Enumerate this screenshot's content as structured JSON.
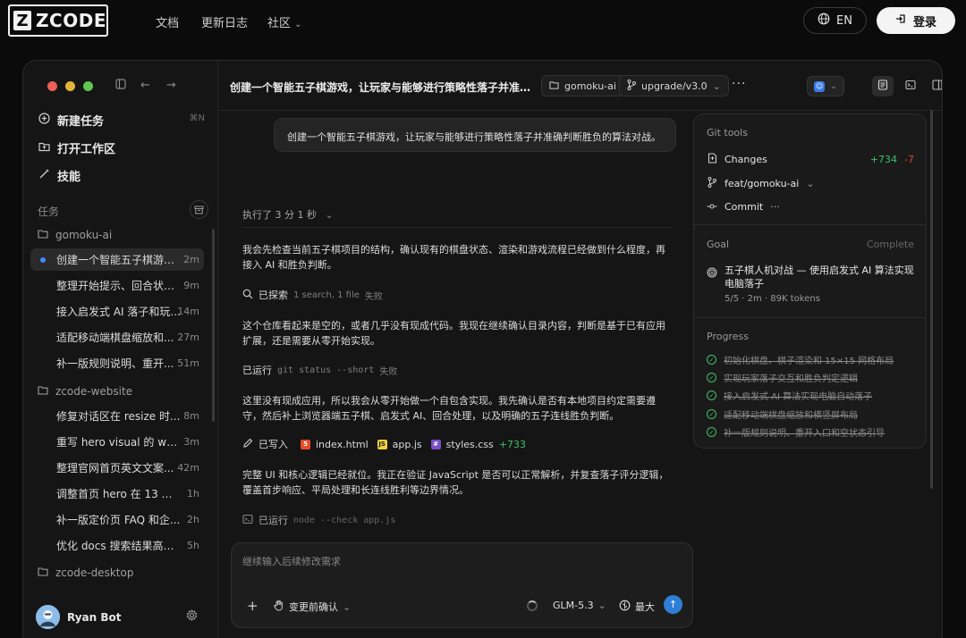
{
  "site": {
    "logo_mark": "Z",
    "logo_text": "ZCODE",
    "nav": [
      "文档",
      "更新日志",
      "社区"
    ],
    "lang": "EN",
    "login": "登录"
  },
  "sidebar": {
    "actions": [
      {
        "label": "新建任务",
        "icon": "plus-circle-icon"
      },
      {
        "label": "打开工作区",
        "icon": "folder-icon"
      },
      {
        "label": "技能",
        "icon": "wand-icon"
      }
    ],
    "new_task_shortcut": "⌘N",
    "section_label": "任务",
    "groups": [
      {
        "name": "gomoku-ai",
        "tasks": [
          {
            "title": "创建一个智能五子棋游戏...",
            "time": "2m",
            "active": true
          },
          {
            "title": "整理开始提示、回合状态...",
            "time": "9m"
          },
          {
            "title": "接入启发式 AI 落子和玩...",
            "time": "14m"
          },
          {
            "title": "适配移动端棋盘缩放和...",
            "time": "27m"
          },
          {
            "title": "补一版规则说明、重开...",
            "time": "51m"
          }
        ]
      },
      {
        "name": "zcode-website",
        "tasks": [
          {
            "title": "修复对话区在 resize 时...",
            "time": "8m"
          },
          {
            "title": "重写 hero visual 的 work...",
            "time": "3m"
          },
          {
            "title": "整理官网首页英文文案...",
            "time": "42m"
          },
          {
            "title": "调整首页 hero 在 13 寸和...",
            "time": "1h"
          },
          {
            "title": "补一版定价页 FAQ 和企...",
            "time": "2h"
          },
          {
            "title": "优化 docs 搜索结果高亮...",
            "time": "5h"
          }
        ]
      },
      {
        "name": "zcode-desktop",
        "tasks": []
      }
    ],
    "user": {
      "name": "Ryan Bot"
    }
  },
  "header": {
    "title": "创建一个智能五子棋游戏，让玩家与能够进行策略性落子并准确判断...",
    "folder": "gomoku-ai",
    "branch": "upgrade/v3.0",
    "more": "···"
  },
  "chat": {
    "user_message": "创建一个智能五子棋游戏，让玩家与能够进行策略性落子并准确判断胜负的算法对战。",
    "elapsed": "执行了 3 分 1 秒",
    "p1": "我会先检查当前五子棋项目的结构，确认现有的棋盘状态、渲染和游戏流程已经做到什么程度，再接入 AI 和胜负判断。",
    "explored": {
      "label": "已探索",
      "detail": "1 search, 1 file",
      "status": "失败"
    },
    "p2": "这个仓库看起来是空的，或者几乎没有现成代码。我现在继续确认目录内容，判断是基于已有应用扩展，还是需要从零开始实现。",
    "ran1": {
      "label": "已运行",
      "cmd": "git status --short",
      "status": "失败"
    },
    "p3": "这里没有现成应用，所以我会从零开始做一个自包含实现。我先确认是否有本地项目约定需要遵守，然后补上浏览器端五子棋、启发式 AI、回合处理，以及明确的五子连线胜负判断。",
    "wrote": {
      "label": "已写入",
      "files": [
        "index.html",
        "app.js",
        "styles.css"
      ],
      "added": "+733"
    },
    "p4": "完整 UI 和核心逻辑已经就位。我正在验证 JavaScript 是否可以正常解析，并复查落子评分逻辑，覆盖首步响应、平局处理和长连线胜利等边界情况。",
    "ran2": {
      "label": "已运行",
      "cmd": "node --check app.js"
    }
  },
  "input": {
    "placeholder": "继续输入后续修改需求",
    "confirm": "变更前确认",
    "model": "GLM-5.3",
    "effort": "最大"
  },
  "panel": {
    "git_tools": "Git tools",
    "changes": {
      "label": "Changes",
      "added": "+734",
      "removed": "-7"
    },
    "branch": "feat/gomoku-ai",
    "commit": "Commit",
    "commit_more": "···",
    "goal_label": "Goal",
    "goal_status": "Complete",
    "goal_title": "五子棋人机对战 — 使用启发式 AI 算法实现电脑落子",
    "goal_meta": "5/5 · 2m · 89K tokens",
    "progress_label": "Progress",
    "progress": [
      "初始化棋盘、棋子渲染和 15×15 网格布局",
      "实现玩家落子交互和胜负判定逻辑",
      "接入启发式 AI 算法实现电脑自动落子",
      "适配移动端棋盘缩放和横竖屏布局",
      "补一版规则说明、重开入口和空状态引导"
    ]
  },
  "colors": {
    "accent": "#2f7fd6",
    "added": "#39c06a",
    "removed": "#e0443e",
    "active_dot": "#3d8bff"
  }
}
